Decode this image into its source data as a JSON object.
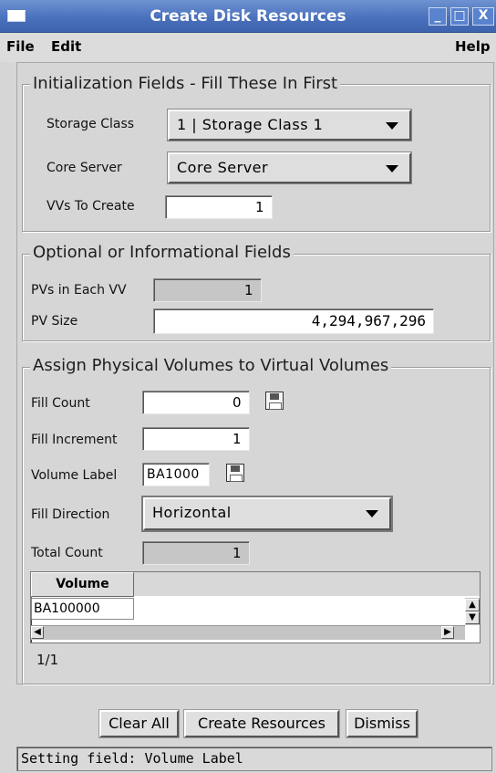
{
  "window": {
    "title": "Create Disk Resources",
    "controls": {
      "minimize": "_",
      "maximize": "□",
      "close": "X"
    }
  },
  "menu": {
    "file": "File",
    "edit": "Edit",
    "help": "Help"
  },
  "init_section": {
    "legend": "Initialization Fields - Fill These In First",
    "storage_class_label": "Storage Class",
    "storage_class_value": "1 | Storage Class 1",
    "core_server_label": "Core Server",
    "core_server_value": "Core Server",
    "vvs_label": "VVs To Create",
    "vvs_value": "1"
  },
  "optional_section": {
    "legend": "Optional or Informational Fields",
    "pvs_label": "PVs in Each VV",
    "pvs_value": "1",
    "pv_size_label": "PV Size",
    "pv_size_value": "4,294,967,296"
  },
  "assign_section": {
    "legend": "Assign Physical Volumes to Virtual Volumes",
    "fill_count_label": "Fill Count",
    "fill_count_value": "0",
    "fill_increment_label": "Fill Increment",
    "fill_increment_value": "1",
    "volume_label_label": "Volume Label",
    "volume_label_value": "BA1000",
    "fill_direction_label": "Fill Direction",
    "fill_direction_value": "Horizontal",
    "total_count_label": "Total Count",
    "total_count_value": "1",
    "table": {
      "header": "Volume",
      "rows": [
        "BA100000"
      ]
    },
    "page_indicator": "1/1"
  },
  "buttons": {
    "clear_all": "Clear All",
    "create_resources": "Create Resources",
    "dismiss": "Dismiss"
  },
  "status": "Setting field: Volume Label"
}
